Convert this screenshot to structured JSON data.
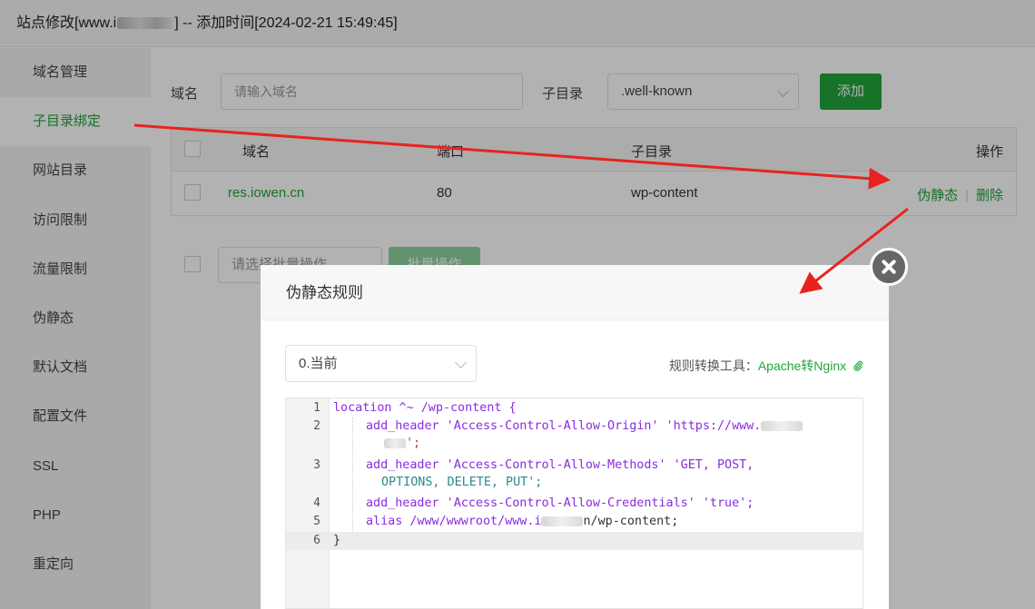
{
  "window": {
    "title_prefix": "站点修改[www.i",
    "title_suffix": "] -- 添加时间[2024-02-21 15:49:45]"
  },
  "sidebar": {
    "items": [
      {
        "label": "域名管理"
      },
      {
        "label": "子目录绑定"
      },
      {
        "label": "网站目录"
      },
      {
        "label": "访问限制"
      },
      {
        "label": "流量限制"
      },
      {
        "label": "伪静态"
      },
      {
        "label": "默认文档"
      },
      {
        "label": "配置文件"
      },
      {
        "label": "SSL"
      },
      {
        "label": "PHP"
      },
      {
        "label": "重定向"
      }
    ],
    "active_index": 1
  },
  "form": {
    "domain_label": "域名",
    "domain_placeholder": "请输入域名",
    "subdir_label": "子目录",
    "subdir_value": ".well-known",
    "add_button": "添加"
  },
  "table": {
    "headers": [
      "域名",
      "端口",
      "子目录",
      "操作"
    ],
    "rows": [
      {
        "domain": "res.iowen.cn",
        "port": "80",
        "subdir": "wp-content",
        "action1": "伪静态",
        "action2": "删除"
      }
    ]
  },
  "batch": {
    "select_placeholder": "请选择批量操作",
    "button": "批量操作"
  },
  "modal": {
    "title": "伪静态规则",
    "rule_select_value": "0.当前",
    "tool_label": "规则转换工具：",
    "tool_link": "Apache转Nginx",
    "code_lines": [
      {
        "num": "1",
        "text": "location ^~ /wp-content {"
      },
      {
        "num": "2",
        "text": "add_header 'Access-Control-Allow-Origin' 'https://www."
      },
      {
        "num": "",
        "text": "';"
      },
      {
        "num": "3",
        "text": "add_header 'Access-Control-Allow-Methods' 'GET, POST,"
      },
      {
        "num": "",
        "text": "OPTIONS, DELETE, PUT';"
      },
      {
        "num": "4",
        "text": "add_header 'Access-Control-Allow-Credentials' 'true';"
      },
      {
        "num": "5",
        "text": "alias /www/wwwroot/www.i"
      },
      {
        "num": "6",
        "text": "}"
      }
    ],
    "code_line5_tail": "n/wp-content;"
  },
  "colors": {
    "accent": "#20a53a",
    "arrow": "#e8231f"
  }
}
